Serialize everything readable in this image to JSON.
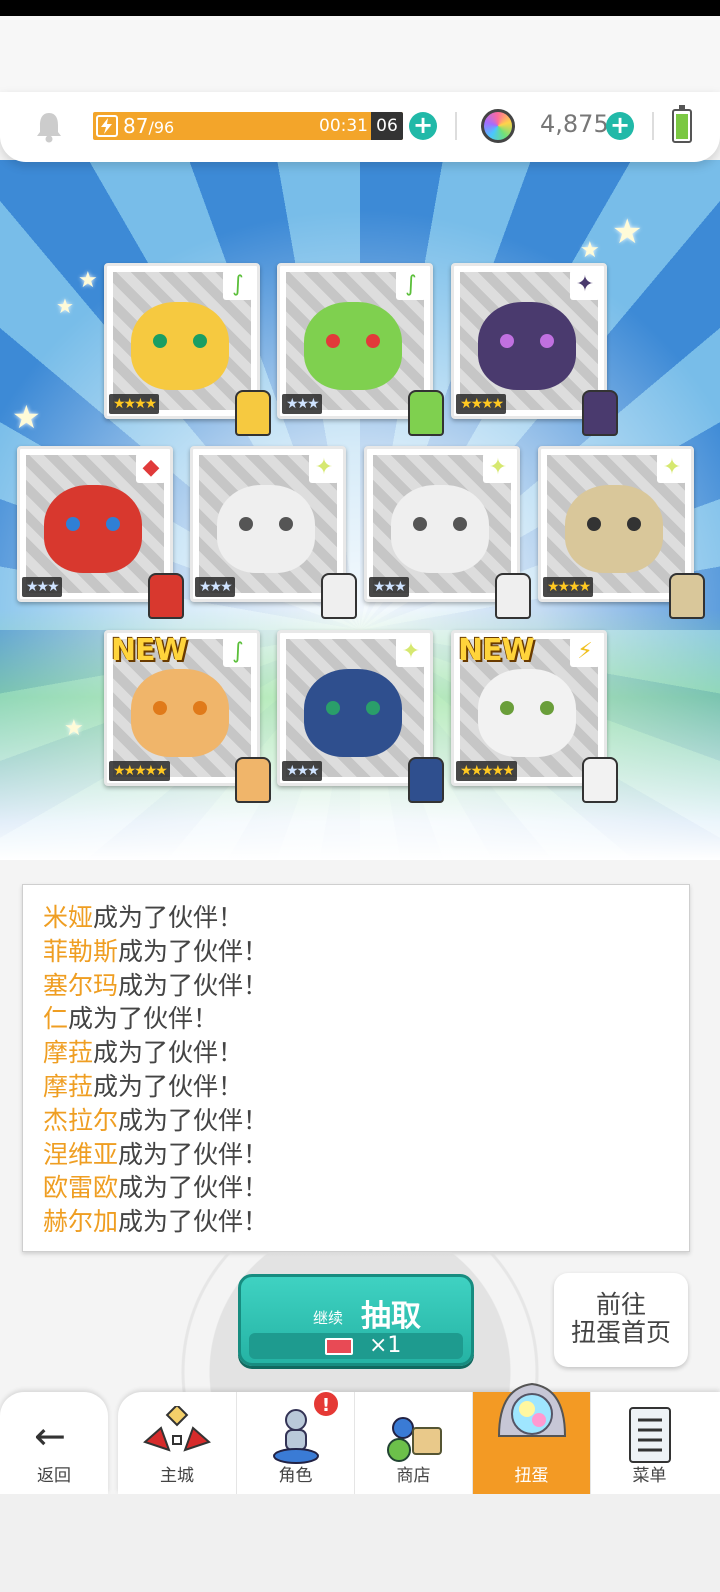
{
  "resources": {
    "stamina_current": "87",
    "stamina_max": "/96",
    "timer": "00:31",
    "timer_seconds": "06",
    "gems": "4,875",
    "plus_symbol": "+"
  },
  "cards": [
    {
      "element": "grass",
      "element_glyph": "∫",
      "stars": "★★★★",
      "rarity": "gold",
      "new": "",
      "theme": "#f6c940",
      "eye": "#1a9e63"
    },
    {
      "element": "grass",
      "element_glyph": "∫",
      "stars": "★★★",
      "rarity": "silver",
      "new": "",
      "theme": "#7fd04f",
      "eye": "#e23a3a"
    },
    {
      "element": "dark",
      "element_glyph": "✦",
      "stars": "★★★★",
      "rarity": "gold",
      "new": "",
      "theme": "#4a3a6e",
      "eye": "#c070e0"
    },
    {
      "element": "fire",
      "element_glyph": "◆",
      "stars": "★★★",
      "rarity": "silver",
      "new": "",
      "theme": "#d8382e",
      "eye": "#2f7fd6"
    },
    {
      "element": "light",
      "element_glyph": "✦",
      "stars": "★★★",
      "rarity": "silver",
      "new": "",
      "theme": "#efefef",
      "eye": "#555555"
    },
    {
      "element": "light",
      "element_glyph": "✦",
      "stars": "★★★",
      "rarity": "silver",
      "new": "",
      "theme": "#efefef",
      "eye": "#555555"
    },
    {
      "element": "light",
      "element_glyph": "✦",
      "stars": "★★★★",
      "rarity": "gold",
      "new": "",
      "theme": "#d9c79a",
      "eye": "#333333"
    },
    {
      "element": "grass",
      "element_glyph": "∫",
      "stars": "★★★★★",
      "rarity": "gold",
      "new": "NEW",
      "theme": "#f0b56a",
      "eye": "#e07a1a"
    },
    {
      "element": "light",
      "element_glyph": "✦",
      "stars": "★★★",
      "rarity": "silver",
      "new": "",
      "theme": "#2f4f8e",
      "eye": "#2a9e6a"
    },
    {
      "element": "thunder",
      "element_glyph": "⚡",
      "stars": "★★★★★",
      "rarity": "gold",
      "new": "NEW",
      "theme": "#f2f2f2",
      "eye": "#6a9e3a"
    }
  ],
  "log": [
    {
      "name": "米娅",
      "suffix": "成为了伙伴！"
    },
    {
      "name": "菲勒斯",
      "suffix": "成为了伙伴！"
    },
    {
      "name": "塞尔玛",
      "suffix": "成为了伙伴！"
    },
    {
      "name": "仁",
      "suffix": "成为了伙伴！"
    },
    {
      "name": "摩菈",
      "suffix": "成为了伙伴！"
    },
    {
      "name": "摩菈",
      "suffix": "成为了伙伴！"
    },
    {
      "name": "杰拉尔",
      "suffix": "成为了伙伴！"
    },
    {
      "name": "涅维亚",
      "suffix": "成为了伙伴！"
    },
    {
      "name": "欧雷欧",
      "suffix": "成为了伙伴！"
    },
    {
      "name": "赫尔加",
      "suffix": "成为了伙伴！"
    }
  ],
  "draw_button": {
    "continue_label": "继续",
    "main_label": "抽取",
    "cost": "×1"
  },
  "goto_button": {
    "line1": "前往",
    "line2": "扭蛋首页"
  },
  "nav": {
    "back": "返回",
    "items": [
      {
        "label": "主城",
        "icon": "castle-icon"
      },
      {
        "label": "角色",
        "icon": "character-icon",
        "badge": "!"
      },
      {
        "label": "商店",
        "icon": "shop-icon"
      },
      {
        "label": "扭蛋",
        "icon": "gacha-icon",
        "active": true
      },
      {
        "label": "菜单",
        "icon": "menu-icon"
      }
    ]
  },
  "colors": {
    "accent": "#21b9a8",
    "highlight": "#ef9e22",
    "nav_active": "#f39a24",
    "stamina": "#f3a52a"
  }
}
